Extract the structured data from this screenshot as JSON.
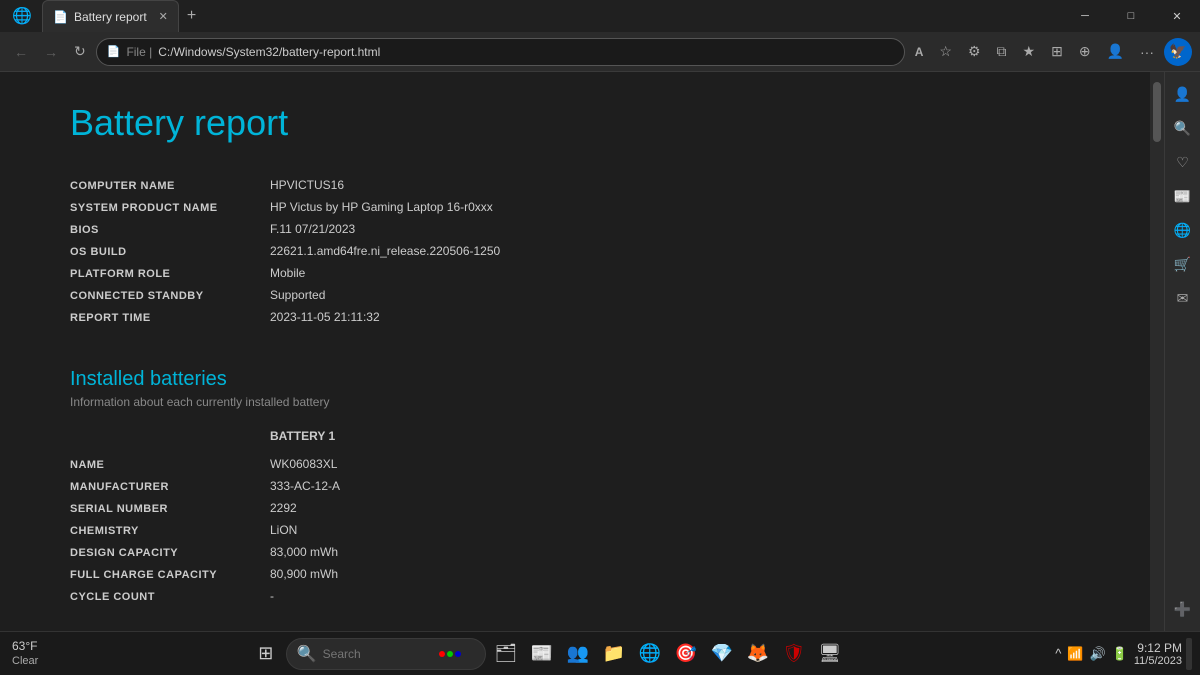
{
  "titlebar": {
    "tab_title": "Battery report",
    "tab_icon": "📄",
    "new_tab_label": "+",
    "minimize": "─",
    "maximize": "□",
    "close": "✕"
  },
  "navbar": {
    "back_icon": "←",
    "forward_icon": "→",
    "refresh_icon": "↻",
    "address_secure_icon": "🔒",
    "address_prefix": "File  |",
    "address_url": "C:/Windows/System32/battery-report.html",
    "read_aloud": "A",
    "favorites": "☆",
    "settings_icon": "⚙",
    "split_view": "⧉",
    "add_fav": "★",
    "collections": "⊞",
    "extensions": "⊕",
    "profile": "👤",
    "more": "···"
  },
  "page": {
    "title": "Battery report",
    "computer_info": {
      "rows": [
        {
          "label": "COMPUTER NAME",
          "value": "HPVICTUS16"
        },
        {
          "label": "SYSTEM PRODUCT NAME",
          "value": "HP Victus by HP Gaming Laptop 16-r0xxx"
        },
        {
          "label": "BIOS",
          "value": "F.11 07/21/2023"
        },
        {
          "label": "OS BUILD",
          "value": "22621.1.amd64fre.ni_release.220506-1250"
        },
        {
          "label": "PLATFORM ROLE",
          "value": "Mobile"
        },
        {
          "label": "CONNECTED STANDBY",
          "value": "Supported"
        },
        {
          "label": "REPORT TIME",
          "value": "2023-11-05   21:11:32"
        }
      ]
    },
    "installed_batteries": {
      "title": "Installed batteries",
      "subtitle": "Information about each currently installed battery",
      "battery_header": "BATTERY 1",
      "rows": [
        {
          "label": "NAME",
          "value": "WK06083XL"
        },
        {
          "label": "MANUFACTURER",
          "value": "333-AC-12-A"
        },
        {
          "label": "SERIAL NUMBER",
          "value": "2292"
        },
        {
          "label": "CHEMISTRY",
          "value": "LiON"
        },
        {
          "label": "DESIGN CAPACITY",
          "value": "83,000 mWh"
        },
        {
          "label": "FULL CHARGE CAPACITY",
          "value": "80,900 mWh"
        },
        {
          "label": "CYCLE COUNT",
          "value": "-"
        }
      ]
    }
  },
  "edge_sidebar": {
    "icons": [
      "👤",
      "🔍",
      "♡",
      "📰",
      "🌐",
      "🛒",
      "✉",
      "➕"
    ]
  },
  "taskbar": {
    "weather_temp": "63°F",
    "weather_condition": "Clear",
    "search_placeholder": "Search",
    "time": "9:12 PM",
    "date": "11/5/2023",
    "apps": [
      "⊞",
      "🗂",
      "●",
      "🟦",
      "📁",
      "🌐",
      "🎯",
      "💎",
      "🦊",
      "🛡",
      "🖥"
    ]
  }
}
